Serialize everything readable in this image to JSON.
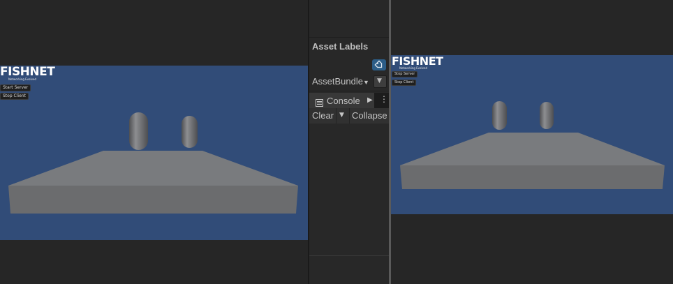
{
  "left_game_view": {
    "logo_text": "FISHNET",
    "tagline": "Networking Evolved",
    "buttons": [
      "Start Server",
      "Stop Client"
    ]
  },
  "right_game_view": {
    "logo_text": "FISHNET",
    "tagline": "Networking Evolved",
    "buttons": [
      "Stop Server",
      "Stop Client"
    ]
  },
  "inspector": {
    "asset_labels_title": "Asset Labels",
    "tag_icon": "tag-icon",
    "asset_bundle_label": "AssetBundle",
    "asset_bundle_dropdown_icon": "chevron-down-icon"
  },
  "console": {
    "tab_label": "Console",
    "tab_icon": "console-icon",
    "clear_label": "Clear",
    "collapse_label": "Collapse"
  },
  "colors": {
    "game_bg": "#314c78",
    "editor_bg": "#282828",
    "tag_button": "#2c5d87"
  }
}
